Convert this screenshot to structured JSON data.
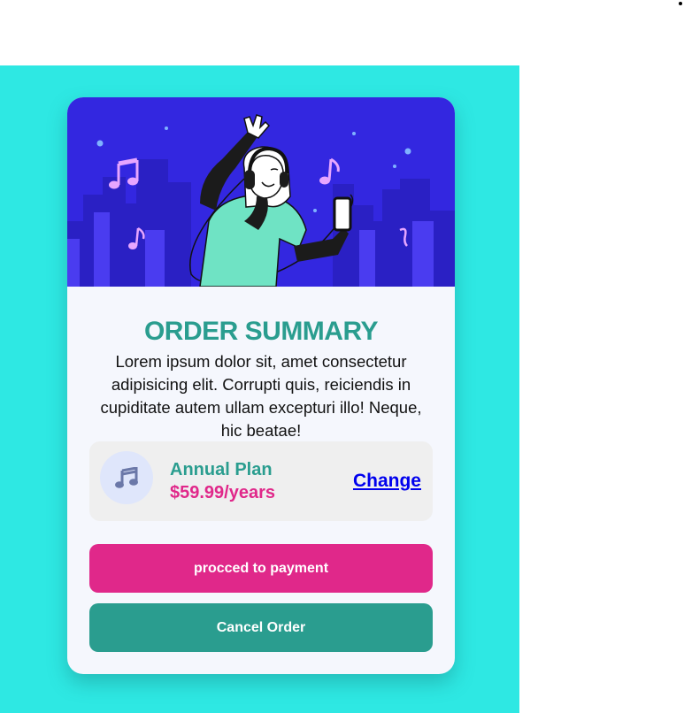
{
  "card": {
    "title": "ORDER SUMMARY",
    "description": "Lorem ipsum dolor sit, amet consectetur adipisicing elit. Corrupti quis, reiciendis in cupiditate autem ullam excepturi illo! Neque, hic beatae!"
  },
  "plan": {
    "icon": "music-note-icon",
    "name": "Annual Plan",
    "price": "$59.99/years",
    "change_label": "Change"
  },
  "buttons": {
    "pay_label": "procced to payment",
    "cancel_label": "Cancel Order"
  },
  "colors": {
    "page_background": "#2ee8e3",
    "hero_background": "#3327e0",
    "title": "#2a9d8f",
    "price": "#e0288a",
    "pay_button": "#e0288a",
    "cancel_button": "#2a9d8f",
    "link": "#0000ee"
  }
}
